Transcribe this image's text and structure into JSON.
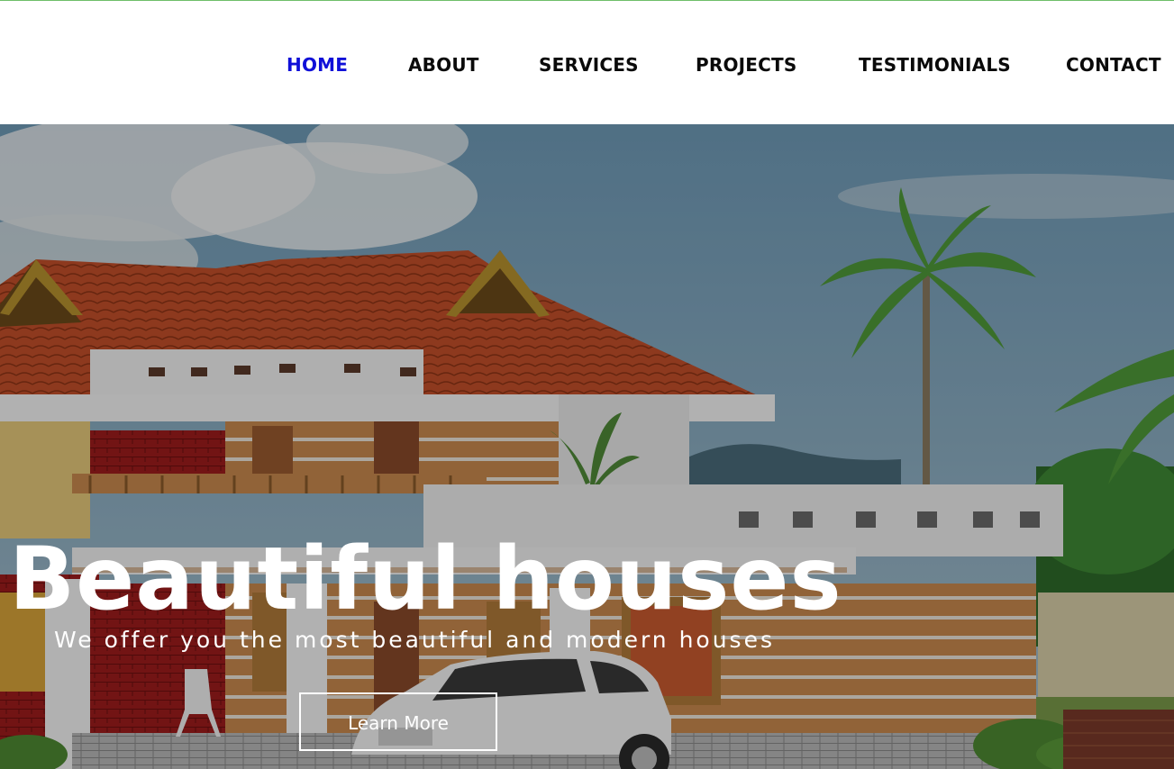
{
  "nav": {
    "items": [
      {
        "label": "HOME",
        "active": true
      },
      {
        "label": "ABOUT",
        "active": false
      },
      {
        "label": "SERVICES",
        "active": false
      },
      {
        "label": "PROJECTS",
        "active": false
      },
      {
        "label": "TESTIMONIALS",
        "active": false
      },
      {
        "label": "CONTACT",
        "active": false
      }
    ],
    "active_color": "#1010d8"
  },
  "hero": {
    "title": "Beautiful houses",
    "subtitle": "We offer you the most beautiful and modern houses",
    "button_label": "Learn More"
  },
  "colors": {
    "accent": "#1010d8",
    "roof": "#c8542a",
    "wall": "#f2f2f2",
    "sky": "#7aa6c4"
  }
}
